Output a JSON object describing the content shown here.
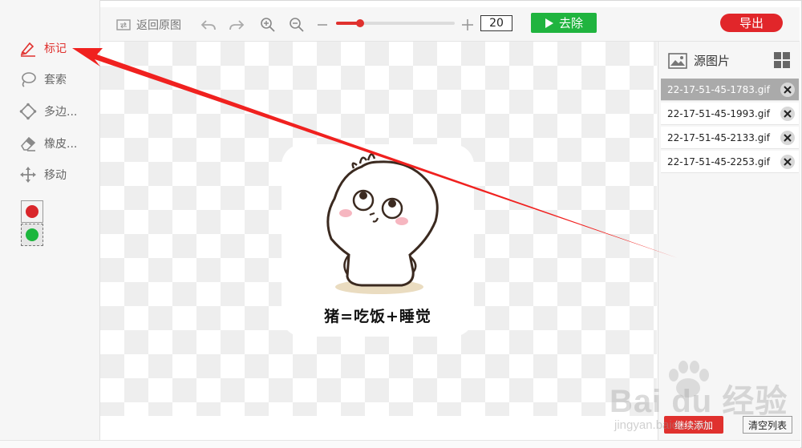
{
  "left_tools": [
    {
      "label": "标记",
      "icon": "marker-pen-icon",
      "active": true
    },
    {
      "label": "套索",
      "icon": "lasso-icon",
      "active": false
    },
    {
      "label": "多边...",
      "icon": "polygon-icon",
      "active": false
    },
    {
      "label": "橡皮...",
      "icon": "eraser-icon",
      "active": false
    },
    {
      "label": "移动",
      "icon": "move-icon",
      "active": false
    }
  ],
  "colors": {
    "red": "#d9262b",
    "green": "#1cb63d",
    "accent": "#e0312e",
    "go": "#20b43f"
  },
  "toolbar": {
    "restore_label": "返回原图",
    "zoom_value": "20",
    "zoom_fraction": 0.2,
    "remove_label": "去除",
    "export_label": "导出"
  },
  "canvas": {
    "caption": "猪=吃饭+睡觉"
  },
  "right_panel": {
    "title": "源图片",
    "files": [
      {
        "name": "22-17-51-45-1783.gif",
        "selected": true
      },
      {
        "name": "22-17-51-45-1993.gif",
        "selected": false
      },
      {
        "name": "22-17-51-45-2133.gif",
        "selected": false
      },
      {
        "name": "22-17-51-45-2253.gif",
        "selected": false
      }
    ],
    "add_label": "继续添加",
    "clear_label": "清空列表"
  },
  "watermark": {
    "word": "Bai du 经验",
    "url": "jingyan.baidu.com"
  }
}
